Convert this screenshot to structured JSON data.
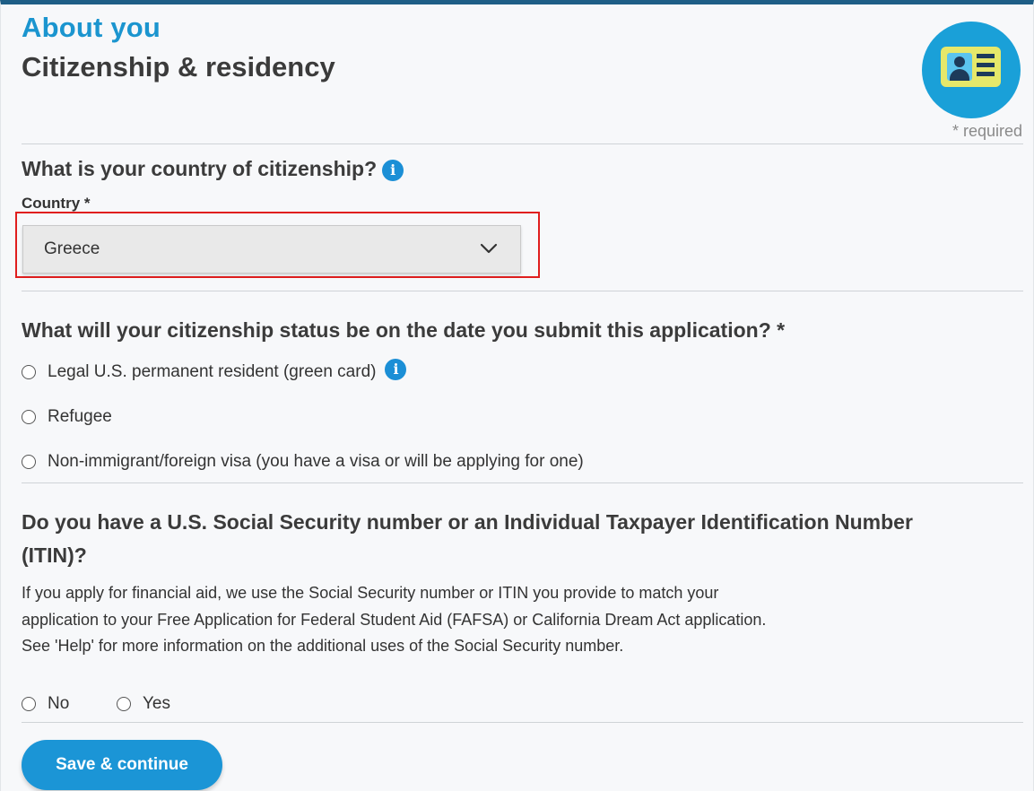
{
  "header": {
    "section_title": "About you",
    "page_title": "Citizenship & residency",
    "required_note": "* required"
  },
  "citizenship": {
    "question": "What is your country of citizenship?",
    "field_label": "Country *",
    "selected_value": "Greece"
  },
  "status": {
    "question": "What will your citizenship status be on the date you submit this application? *",
    "options": [
      "Legal U.S. permanent resident (green card)",
      "Refugee",
      "Non-immigrant/foreign visa (you have a visa or will be applying for one)"
    ]
  },
  "ssn": {
    "question_line1": "Do you have a U.S. Social Security number or an Individual Taxpayer Identification Number",
    "question_line2": "(ITIN)?",
    "help_text": "If you apply for financial aid, we use the Social Security number or ITIN you provide to match your application to your Free Application for Federal Student Aid (FAFSA) or California Dream Act application. See 'Help' for more information on the additional uses of the Social Security number.",
    "options": [
      "No",
      "Yes"
    ]
  },
  "actions": {
    "save_label": "Save & continue"
  },
  "icons": {
    "badge": "id-card-icon",
    "info": "info-icon",
    "dropdown": "chevron-down-icon"
  },
  "colors": {
    "accent": "#1b95cf",
    "button": "#1b95d6",
    "highlight_border": "#e01e1e",
    "top_bar": "#1e5e86"
  }
}
